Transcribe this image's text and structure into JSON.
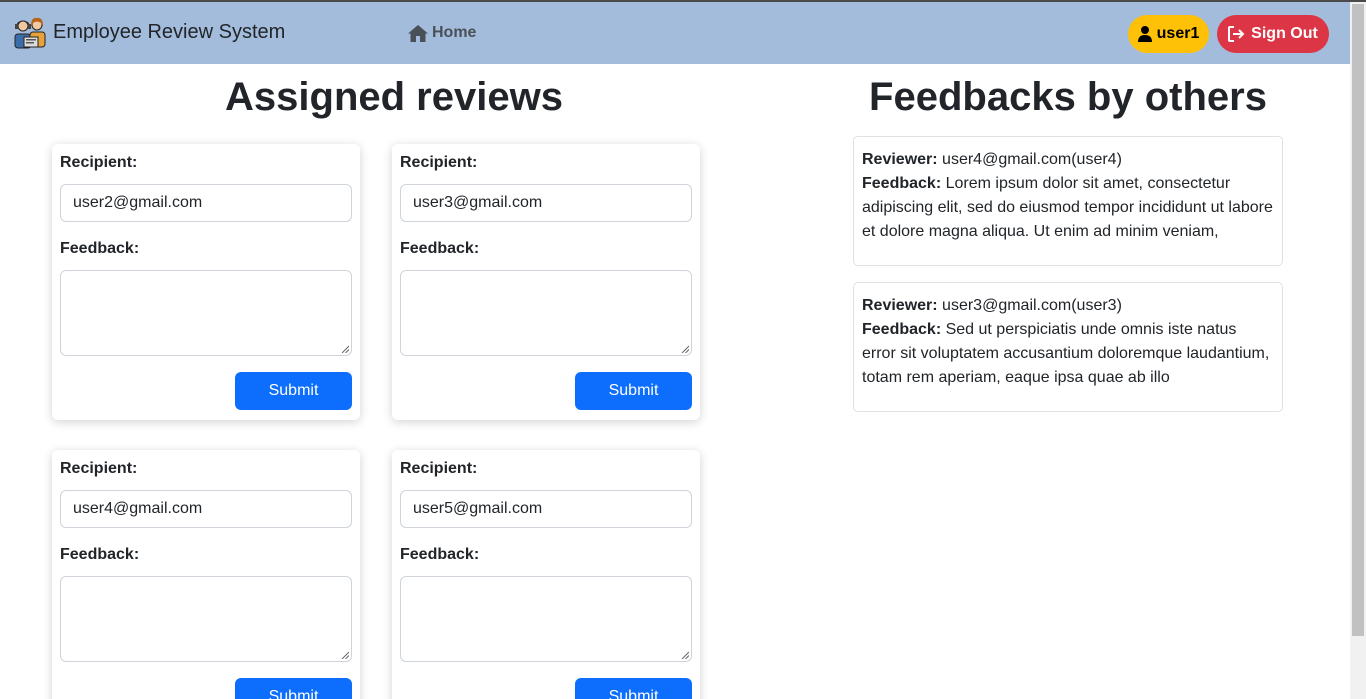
{
  "navbar": {
    "brand_title": "Employee Review System",
    "brand_logo_icon": "employees-icon",
    "home_label": "Home",
    "home_icon": "house-icon",
    "user_label": "user1",
    "user_icon": "person-icon",
    "signout_label": "Sign Out",
    "signout_icon": "sign-out-icon",
    "bg_color": "#a3bcdb",
    "user_color": "#ffc107",
    "signout_color": "#dc3545"
  },
  "assigned": {
    "heading": "Assigned reviews",
    "recipient_label": "Recipient:",
    "feedback_label": "Feedback:",
    "submit_label": "Submit",
    "submit_color": "#0d6efd",
    "reviews": [
      {
        "recipient": "user2@gmail.com",
        "feedback": ""
      },
      {
        "recipient": "user3@gmail.com",
        "feedback": ""
      },
      {
        "recipient": "user4@gmail.com",
        "feedback": ""
      },
      {
        "recipient": "user5@gmail.com",
        "feedback": ""
      }
    ]
  },
  "feedbacks": {
    "heading": "Feedbacks by others",
    "reviewer_label": "Reviewer:",
    "feedback_label": "Feedback:",
    "items": [
      {
        "reviewer": "user4@gmail.com(user4)",
        "feedback": "Lorem ipsum dolor sit amet, consectetur adipiscing elit, sed do eiusmod tempor incididunt ut labore et dolore magna aliqua. Ut enim ad minim veniam,"
      },
      {
        "reviewer": "user3@gmail.com(user3)",
        "feedback": "Sed ut perspiciatis unde omnis iste natus error sit voluptatem accusantium doloremque laudantium, totam rem aperiam, eaque ipsa quae ab illo"
      }
    ]
  }
}
